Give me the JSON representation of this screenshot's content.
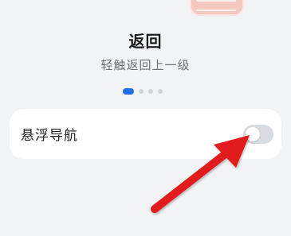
{
  "header": {
    "title": "返回",
    "subtitle": "轻触返回上一级"
  },
  "pager": {
    "pages": 4,
    "active_index": 0,
    "active_color": "#1f6de8"
  },
  "settings": {
    "floating_nav": {
      "label": "悬浮导航",
      "enabled": false
    }
  },
  "annotation": {
    "arrow_color": "#e21d1d",
    "points_to": "floating-nav-toggle"
  }
}
